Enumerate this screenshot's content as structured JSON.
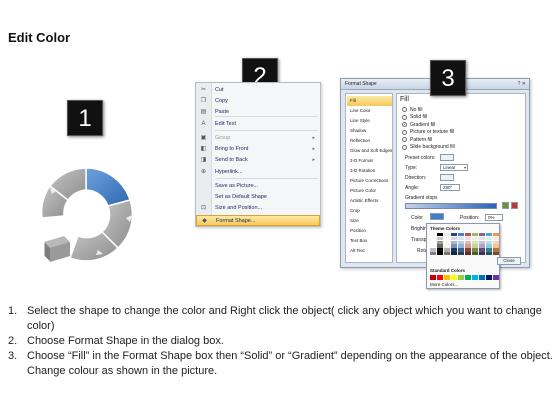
{
  "title": "Edit Color",
  "badges": [
    "1",
    "2",
    "3"
  ],
  "context_menu": {
    "items": [
      {
        "label": "Cut",
        "icon": "scissors-icon",
        "glyph": "✂",
        "disabled": false,
        "submenu": false
      },
      {
        "label": "Copy",
        "icon": "copy-icon",
        "glyph": "❐",
        "disabled": false,
        "submenu": false
      },
      {
        "label": "Paste",
        "icon": "paste-icon",
        "glyph": "▤",
        "disabled": false,
        "submenu": false
      },
      {
        "label": "Edit Text",
        "icon": "text-icon",
        "glyph": "A",
        "disabled": false,
        "submenu": false
      },
      {
        "label": "Group",
        "icon": "group-icon",
        "glyph": "▣",
        "disabled": true,
        "submenu": true
      },
      {
        "label": "Bring to Front",
        "icon": "bring-front-icon",
        "glyph": "◧",
        "disabled": false,
        "submenu": true
      },
      {
        "label": "Send to Back",
        "icon": "send-back-icon",
        "glyph": "◨",
        "disabled": false,
        "submenu": true
      },
      {
        "label": "Hyperlink...",
        "icon": "hyperlink-icon",
        "glyph": "⊕",
        "disabled": false,
        "submenu": false
      },
      {
        "label": "Save as Picture...",
        "icon": "",
        "glyph": "",
        "disabled": false,
        "submenu": false
      },
      {
        "label": "Set as Default Shape",
        "icon": "",
        "glyph": "",
        "disabled": false,
        "submenu": false
      },
      {
        "label": "Size and Position...",
        "icon": "size-icon",
        "glyph": "⊡",
        "disabled": false,
        "submenu": false
      },
      {
        "label": "Format Shape...",
        "icon": "format-shape-icon",
        "glyph": "◆",
        "disabled": false,
        "submenu": false,
        "highlighted": true
      }
    ]
  },
  "format_dialog": {
    "title": "Format Shape",
    "window_buttons": "? ✕",
    "nav_items": [
      "Fill",
      "Line Color",
      "Line Style",
      "Shadow",
      "Reflection",
      "Glow and Soft Edges",
      "3-D Format",
      "3-D Rotation",
      "Picture Corrections",
      "Picture Color",
      "Artistic Effects",
      "Crop",
      "Size",
      "Position",
      "Text Box",
      "Alt Text"
    ],
    "selected_nav": "Fill",
    "pane_heading": "Fill",
    "fill_options": [
      "No fill",
      "Solid fill",
      "Gradient fill",
      "Picture or texture fill",
      "Pattern fill",
      "Slide background fill"
    ],
    "selected_fill": "Gradient fill",
    "fields": {
      "preset_label": "Preset colors:",
      "type_label": "Type:",
      "type_value": "Linear",
      "direction_label": "Direction:",
      "angle_label": "Angle:",
      "angle_value": "280°",
      "stops_label": "Gradient stops",
      "color_label": "Color",
      "position_label": "Position:",
      "position_value": "0%",
      "brightness_label": "Brightness",
      "transparency_label": "Transparen",
      "rotate_label": "Rotate"
    },
    "close_label": "Close"
  },
  "color_palette": {
    "theme_label": "Theme Colors",
    "standard_label": "Standard Colors",
    "more_label": "More Colors...",
    "theme_top": [
      "#ffffff",
      "#000000",
      "#eeece1",
      "#1f497d",
      "#4f81bd",
      "#c0504d",
      "#9bbb59",
      "#8064a2",
      "#4bacc6",
      "#f79646"
    ],
    "standard": [
      "#c00000",
      "#ff0000",
      "#ffc000",
      "#ffff00",
      "#92d050",
      "#00b050",
      "#00b0f0",
      "#0070c0",
      "#002060",
      "#7030a0"
    ]
  },
  "instructions": [
    {
      "num": "1.",
      "text": "Select the shape to change the color and Right click the object( click any object which you want to change color)"
    },
    {
      "num": "2.",
      "text": "Choose Format Shape in the dialog box."
    },
    {
      "num": "3.",
      "text": "Choose “Fill” in the Format Shape box then “Solid” or “Gradient” depending on the appearance of the object. Change colour as shown in the picture."
    }
  ],
  "colors": {
    "ring_gray": "#a8a8a8",
    "ring_highlight": "#3f7fc8",
    "menu_highlight": "#f8c85a"
  }
}
